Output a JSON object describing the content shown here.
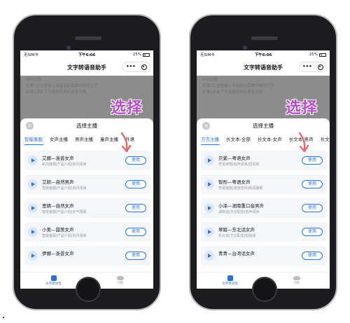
{
  "status": {
    "carrier": "无SIM卡",
    "time": "下午6:06",
    "battery": "25%"
  },
  "app": {
    "title": "文字转语音助手",
    "menu_dots": "•••"
  },
  "background_text": [
    "制作过程",
    "步骤1在这里输入或者粘贴需要转换的文字",
    "步骤2点击下方选择转换的语音主播"
  ],
  "sheet": {
    "title": "选择主播",
    "close": "×"
  },
  "callout": "选择",
  "colors": {
    "accent": "#2a73d9",
    "callout": "#b44dc7",
    "arrow": "#e46a6a"
  },
  "left": {
    "tabs": [
      "智能客服",
      "女声主播",
      "男声主播",
      "童声主播",
      "外语"
    ],
    "active_tab": 0,
    "voices": [
      {
        "name": "艾娜—浙普女声",
        "tags": "新闻播报|产品介绍|资讯阅读",
        "action": "使用"
      },
      {
        "name": "艾硕—自然男声",
        "tags": "智能客服|产品介绍|资讯阅读",
        "action": "使用"
      },
      {
        "name": "思婧—自然女声",
        "tags": "智能客服|产品介绍|天气预报",
        "action": "使用"
      },
      {
        "name": "小美—甜美女声",
        "tags": "智能客服|产品介绍|资讯阅读",
        "action": "使用"
      },
      {
        "name": "伊娜—浙普女声",
        "tags": "",
        "action": "使用"
      }
    ]
  },
  "right": {
    "tabs": [
      "方言主播",
      "长文本-全部",
      "长文本-女声",
      "长文本-男声",
      "长文"
    ],
    "active_tab": 0,
    "voices": [
      {
        "name": "贝紫—粤语女声",
        "tags": "粤语读物|有声阅读|短视频",
        "action": "使用"
      },
      {
        "name": "智彤—粤语女声",
        "tags": "粤语播报|旅游宣传|新闻播报",
        "action": "使用"
      },
      {
        "name": "小泽—湖南重口音男声",
        "tags": "湖南话|方言配音|有声阅读",
        "action": "使用"
      },
      {
        "name": "翠姐—东北话女声",
        "tags": "东北话|方言配音|短视频",
        "action": "使用"
      },
      {
        "name": "青青—台湾话女声",
        "tags": "",
        "action": "使用"
      }
    ]
  },
  "nav": {
    "tts_label": "文字转语音",
    "intro_label": "介绍"
  }
}
